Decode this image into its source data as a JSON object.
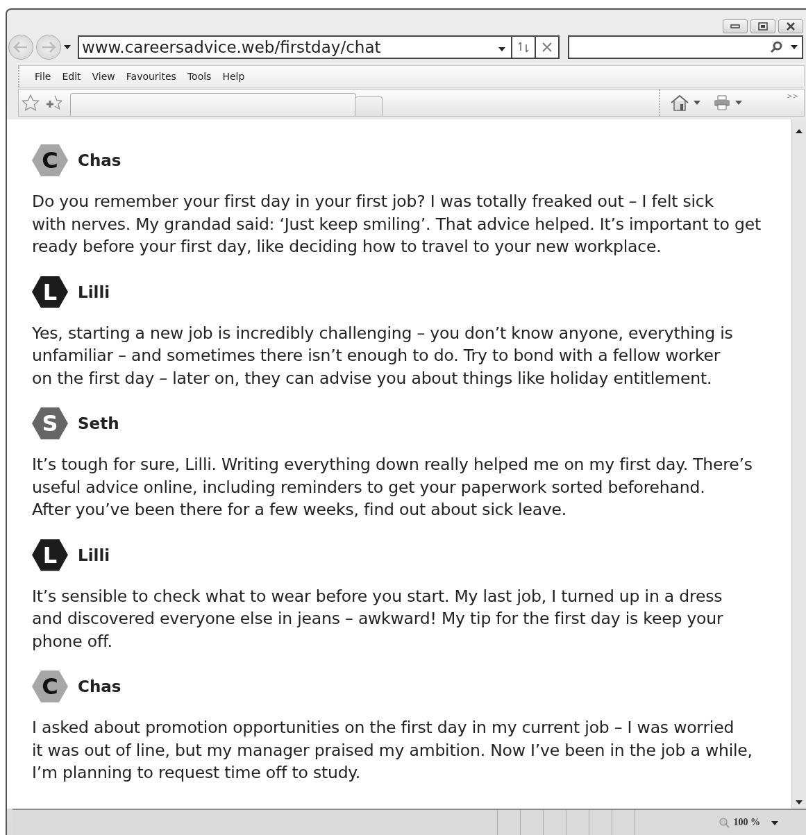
{
  "address_bar": {
    "url": "www.careersadvice.web/firstday/chat"
  },
  "menu": [
    "File",
    "Edit",
    "View",
    "Favourites",
    "Tools",
    "Help"
  ],
  "command_bar": {
    "overflow": ">>"
  },
  "messages": [
    {
      "author": "Chas",
      "initial": "C",
      "color": "#a6a6a6",
      "text": "Do you remember your first day in your first job? I was totally freaked out – I felt sick\nwith nerves. My grandad said: ‘Just keep smiling’. That advice helped. It’s important to get\nready before your first day, like deciding how to travel to your new workplace."
    },
    {
      "author": "Lilli",
      "initial": "L",
      "color": "#1c1c1c",
      "text": "Yes, starting a new job is incredibly challenging – you don’t know anyone, everything is\nunfamiliar – and sometimes there isn’t enough to do. Try to bond with a fellow worker\non the first day – later on, they can advise you about things like holiday entitlement."
    },
    {
      "author": "Seth",
      "initial": "S",
      "color": "#666666",
      "text": "It’s tough for sure, Lilli. Writing everything down really helped me on my first day. There’s\nuseful advice online, including reminders to get your paperwork sorted beforehand.\nAfter you’ve been there for a few weeks, find out about sick leave."
    },
    {
      "author": "Lilli",
      "initial": "L",
      "color": "#1c1c1c",
      "text": "It’s sensible to check what to wear before you start. My last job, I turned up in a dress\nand discovered everyone else in jeans – awkward! My tip for the first day is keep your\nphone off."
    },
    {
      "author": "Chas",
      "initial": "C",
      "color": "#a6a6a6",
      "text": "I asked about promotion opportunities on the first day in my current job – I was worried\nit was out of line, but my manager praised my ambition. Now I’ve been in the job a while,\nI’m planning to request time off to study."
    }
  ],
  "status_bar": {
    "zoom": "100 %"
  }
}
